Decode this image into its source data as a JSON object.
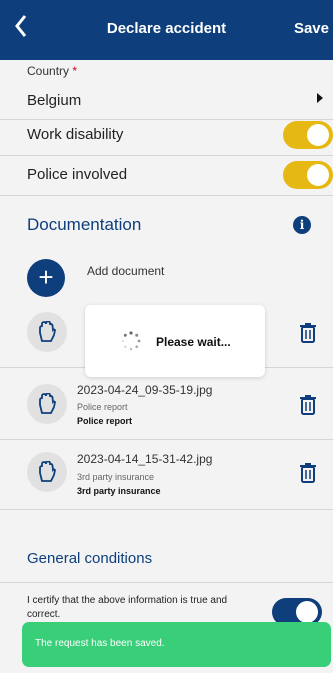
{
  "header": {
    "back_icon": "chevron-left-icon",
    "title": "Declare accident",
    "save_label": "Save",
    "color": "#0e3f7c"
  },
  "form": {
    "country_label": "Country",
    "required_mark": "*",
    "country_value": "Belgium",
    "work_disability_label": "Work disability",
    "work_disability_on": true,
    "police_involved_label": "Police involved",
    "police_involved_on": true,
    "toggle_color": "#e6b813"
  },
  "documentation": {
    "title": "Documentation",
    "info_icon": "info-icon",
    "add_label": "Add document",
    "documents": [
      {
        "name": "",
        "subtitle": "",
        "type": ""
      },
      {
        "name": "2023-04-24_09-35-19.jpg",
        "subtitle": "Police report",
        "type": "Police report"
      },
      {
        "name": "2023-04-14_15-31-42.jpg",
        "subtitle": "3rd party insurance",
        "type": "3rd party insurance"
      }
    ]
  },
  "loading": {
    "text": "Please wait..."
  },
  "general_conditions": {
    "title": "General conditions",
    "certify_text": "I certify that the above information is true and correct.",
    "certify_on": true
  },
  "toast": {
    "text": "The request has been saved.",
    "color": "#39cf79"
  }
}
